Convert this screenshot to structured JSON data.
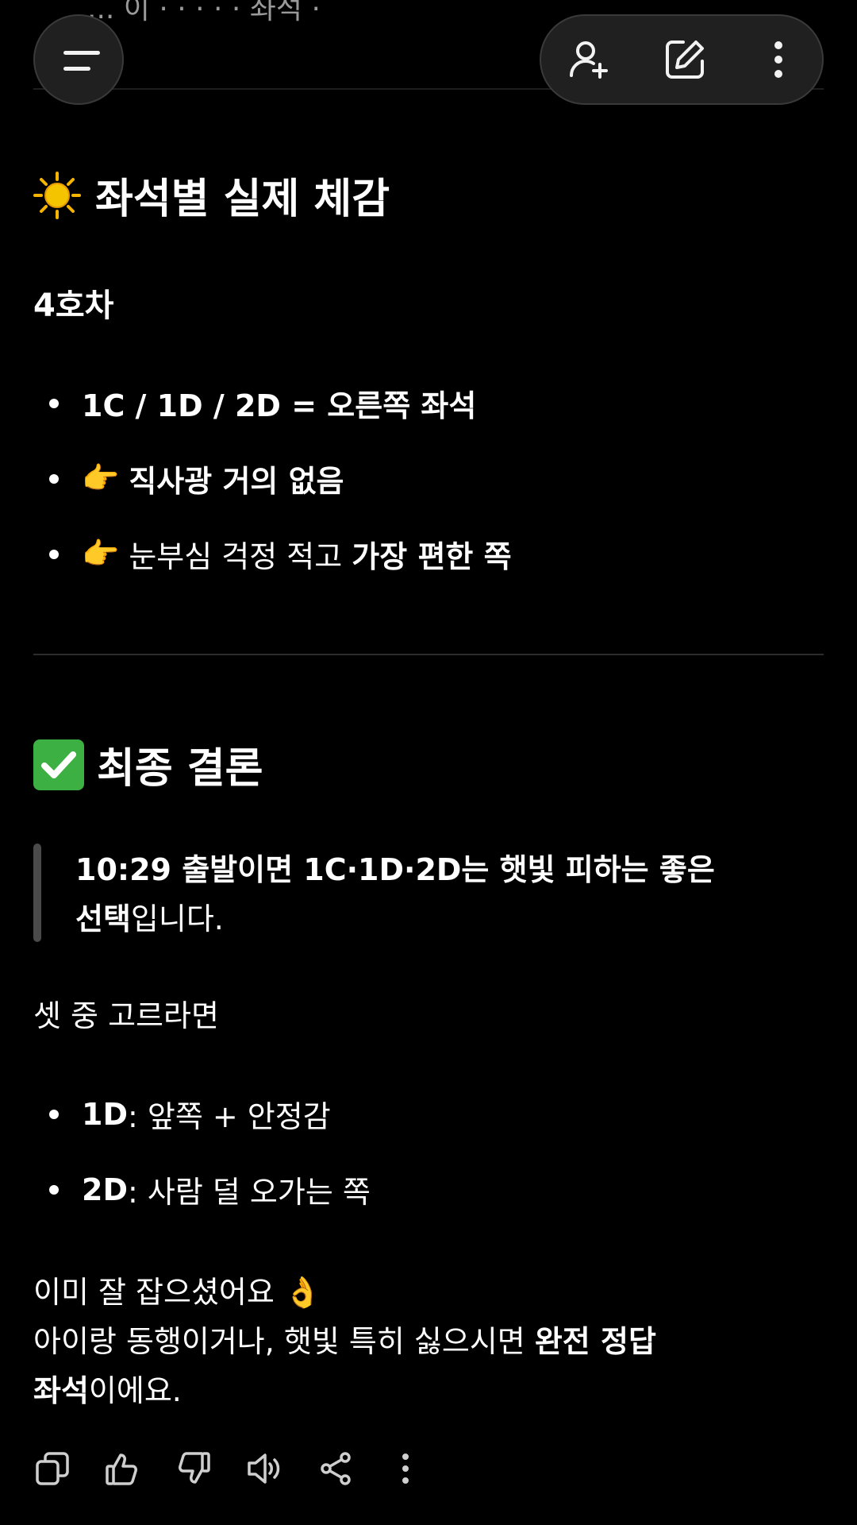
{
  "top_cutoff_text": "... 이 · · · · · 좌석 ·",
  "header": {
    "menu_icon": "hamburger-icon",
    "actions": [
      "add-person-icon",
      "edit-icon",
      "more-vertical-icon"
    ]
  },
  "section1": {
    "emoji": "sun",
    "title": "좌석별 실제 체감",
    "subtitle": "4호차",
    "bullets": [
      {
        "text": "1C / 1D / 2D = 오른쪽 좌석"
      },
      {
        "emoji": "👉",
        "text": "직사광 거의 없음"
      },
      {
        "emoji": "👉",
        "text": "눈부심 걱정 적고 ",
        "bold": "가장 편한 쪽"
      }
    ]
  },
  "section2": {
    "emoji": "check",
    "title": "최종 결론",
    "quote_line1": "10:29 출발이면 1C·1D·2D는 햇빛 피하는 좋은",
    "quote_line2_bold": "선택",
    "quote_line2_rest": "입니다.",
    "choose_text": "셋 중 고르라면",
    "options": [
      {
        "seat": "1D",
        "desc": ": 앞쪽 + 안정감"
      },
      {
        "seat": "2D",
        "desc": ": 사람 덜 오가는 쪽"
      }
    ],
    "closing_line1": "이미 잘 잡으셨어요 👌",
    "closing_line2": "아이랑 동행이거나, 햇빛 특히 싫으시면 ",
    "closing_line2_bold": "완전 정답",
    "closing_line3_bold": "좌석",
    "closing_line3_rest": "이에요."
  },
  "footer": {
    "icons": [
      "copy-icon",
      "thumbs-up-icon",
      "thumbs-down-icon",
      "speaker-icon",
      "share-icon",
      "more-vertical-icon"
    ]
  },
  "colors": {
    "background": "#000000",
    "text": "#ffffff",
    "pill": "#202020",
    "check": "#3cb043",
    "sun": "#f5b400"
  }
}
